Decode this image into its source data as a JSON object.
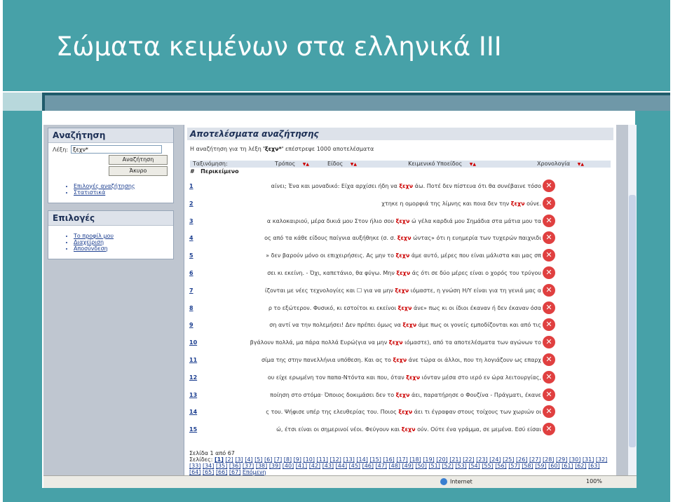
{
  "slide": {
    "title": "Σώματα κειμένων στα ελληνικά III"
  },
  "search_box": {
    "header": "Αναζήτηση",
    "label": "Λέξη:",
    "value": "ξεχν*",
    "search_button": "Αναζήτηση",
    "cancel_button": "Άκυρο",
    "links": [
      "Επιλογές αναζήτησης",
      "Στατιστικά"
    ]
  },
  "options_box": {
    "header": "Επιλογές",
    "links": [
      "Το προφίλ μου",
      "Διαχείριση",
      "Αποσύνδεση"
    ]
  },
  "results": {
    "header": "Αποτελέσματα αναζήτησης",
    "summary_prefix": "Η αναζήτηση για τη λέξη",
    "query": "'ξεχν*'",
    "summary_suffix": "επέστρεψε 1000 αποτελέσματα",
    "sort_label": "Ταξινόμηση:",
    "sort_columns": [
      "Τρόπος",
      "Είδος",
      "Κειμενικό Υποείδος",
      "Χρονολογία"
    ],
    "col_hash": "#",
    "col_context": "Περικείμενο",
    "keyword": "ξεχν",
    "rows": [
      {
        "n": "1",
        "pre": "αίνει; Ένα και μοναδικό: Είχα αρχίσει ήδη να ",
        "post": " άω. Ποτέ δεν πίστευα ότι θα συνέβαινε τόσο"
      },
      {
        "n": "2",
        "pre": "χτηκε η ομορφιά της λίμνης και ποια δεν την ",
        "post": " ούνε."
      },
      {
        "n": "3",
        "pre": "α καλοκαιριού, μέρα δικιά μου Στον ήλιο σου ",
        "post": " ώ γέλα καρδιά μου Σημάδια στα μάτια μου τα"
      },
      {
        "n": "4",
        "pre": "ος από τα κάθε είδους παίγνια αυξήθηκε (σ. σ. ",
        "post": " ώντας» ότι η ευημερία των τυχερών παιχνιδι"
      },
      {
        "n": "5",
        "pre": "» δεν βαρούν μόνο οι επιχειρήσεις. Ας μην το ",
        "post": " άμε αυτό, μέρες που είναι μάλιστα και μας σπ"
      },
      {
        "n": "6",
        "pre": "σει κι εκείνη. - Όχι, καπετάνιο, θα φύγω. Μην ",
        "post": " άς ότι σε δύο μέρες είναι ο χορός του τρύγου"
      },
      {
        "n": "7",
        "pre": "ίζονται με νέες τεχνολογίες και ☐ για να μην ",
        "post": " ιόμαστε, η γνώση Η/Υ είναι για τη γενιά μας α"
      },
      {
        "n": "8",
        "pre": "ρ το εξώτερον. Φυσικό, κι εστοίτοι κι εκείνοι ",
        "post": " άνε» πως κι οι ίδιοι έκαναν ή δεν έκαναν όσα"
      },
      {
        "n": "9",
        "pre": "ση αντί να την πολεμήσει! Δεν πρέπει όμως να ",
        "post": " άμε πως οι γονείς εμποδίζονται και από τις"
      },
      {
        "n": "10",
        "pre": "βγάλουν πολλά, μα πάρα πολλά Ευρώ(για να μην ",
        "post": " ιόμαστε), από τα αποτελέσματα των αγώνων το"
      },
      {
        "n": "11",
        "pre": "σίμα της στην πανελλήνια υπόθεση. Και ας το ",
        "post": " άνε τώρα οι άλλοι, που τη λογιάζουν ως επαρχ"
      },
      {
        "n": "12",
        "pre": "ου είχε ερωμένη τον παπα-Ντόντα και που, όταν ",
        "post": " ιόνταν μέσα στο ιερό εν ώρα λειτουργίας,"
      },
      {
        "n": "13",
        "pre": "ποίηση στο στόμα· Όποιος δοκιμάσει δεν το ",
        "post": " άει, παρατήρησε ο Φουζίνα - Πράγματι, έκανε"
      },
      {
        "n": "14",
        "pre": "ς του. Ψήφισε υπέρ της ελευθερίας του. Ποιος ",
        "post": " άει τι έγραφαν στους τοίχους των χωριών οι"
      },
      {
        "n": "15",
        "pre": "ώ, έτσι είναι οι σημερινοί νέοι. Φεύγουν και ",
        "post": " ούν. Ούτε ένα γράμμα, σε μεμένα. Εσύ είσαι"
      }
    ],
    "page_info": "Σελίδα 1 από 67",
    "pages_label": "Σελίδες:",
    "pages": [
      "[1]",
      "[2]",
      "[3]",
      "[4]",
      "[5]",
      "[6]",
      "[7]",
      "[8]",
      "[9]",
      "[10]",
      "[11]",
      "[12]",
      "[13]",
      "[14]",
      "[15]",
      "[16]",
      "[17]",
      "[18]",
      "[19]",
      "[20]",
      "[21]",
      "[22]",
      "[23]",
      "[24]",
      "[25]",
      "[26]",
      "[27]",
      "[28]",
      "[29]",
      "[30]",
      "[31]",
      "[32]",
      "[33]",
      "[34]",
      "[35]",
      "[36]",
      "[37]",
      "[38]",
      "[39]",
      "[40]",
      "[41]",
      "[42]",
      "[43]",
      "[44]",
      "[45]",
      "[46]",
      "[47]",
      "[48]",
      "[49]",
      "[50]",
      "[51]",
      "[52]",
      "[53]",
      "[54]",
      "[55]",
      "[56]",
      "[57]",
      "[58]",
      "[59]",
      "[60]",
      "[61]",
      "[62]",
      "[63]",
      "[64]",
      "[65]",
      "[66]",
      "[67]"
    ],
    "next_label": "Επόμενη"
  },
  "statusbar": {
    "zone": "Internet",
    "zoom": "100%"
  },
  "icons": {
    "delete": "delete-icon",
    "sort": "sort-arrow-icon",
    "globe": "globe-icon"
  }
}
